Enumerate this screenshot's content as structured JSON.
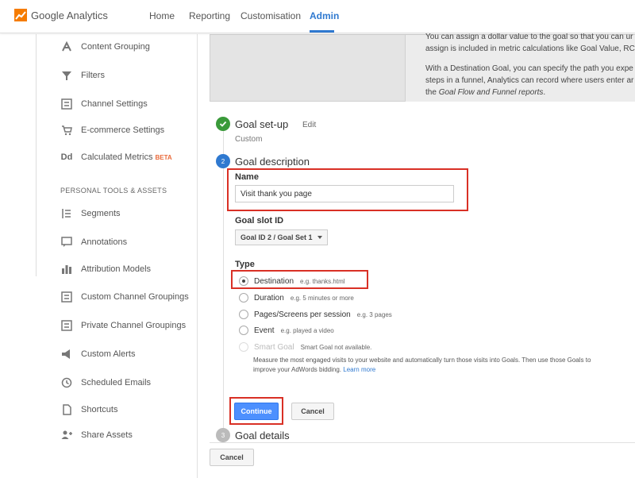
{
  "app": {
    "logo_text": "Google Analytics",
    "brand_color": "#f57c00",
    "accent": "#2f79d0"
  },
  "nav": {
    "items": [
      {
        "label": "Home"
      },
      {
        "label": "Reporting"
      },
      {
        "label": "Customisation"
      },
      {
        "label": "Admin"
      }
    ],
    "active": "Admin"
  },
  "sidebar": {
    "items": [
      {
        "label": "Content Grouping",
        "icon": "content-grouping-icon"
      },
      {
        "label": "Filters",
        "icon": "filter-icon"
      },
      {
        "label": "Channel Settings",
        "icon": "channel-settings-icon"
      },
      {
        "label": "E-commerce Settings",
        "icon": "cart-icon"
      },
      {
        "label": "Calculated Metrics",
        "icon": "calculated-metrics-icon",
        "badge": "BETA"
      }
    ],
    "section_heading": "PERSONAL TOOLS & ASSETS",
    "personal_items": [
      {
        "label": "Segments",
        "icon": "segments-icon"
      },
      {
        "label": "Annotations",
        "icon": "annotations-icon"
      },
      {
        "label": "Attribution Models",
        "icon": "attribution-icon"
      },
      {
        "label": "Custom Channel Groupings",
        "icon": "custom-channel-icon"
      },
      {
        "label": "Private Channel Groupings",
        "icon": "private-channel-icon"
      },
      {
        "label": "Custom Alerts",
        "icon": "megaphone-icon"
      },
      {
        "label": "Scheduled Emails",
        "icon": "clock-icon"
      },
      {
        "label": "Shortcuts",
        "icon": "document-icon"
      },
      {
        "label": "Share Assets",
        "icon": "add-person-icon"
      }
    ]
  },
  "info": {
    "line1": "You can assign a dollar value to the goal so that you can ur",
    "line2": "assign is included in metric calculations like Goal Value, RC",
    "line3": "With a Destination Goal, you can specify the path you expe",
    "line4": "steps in a funnel, Analytics can record where users enter ar",
    "line5_italic": "Goal Flow and Funnel reports",
    "line5_pre": "the ",
    "line5_post": "."
  },
  "steps": {
    "setup": {
      "title": "Goal set-up",
      "edit": "Edit",
      "value": "Custom"
    },
    "description": {
      "number": "2",
      "title": "Goal description"
    },
    "details": {
      "number": "3",
      "title": "Goal details"
    }
  },
  "form": {
    "name_label": "Name",
    "name_value": "Visit thank you page",
    "slot_label": "Goal slot ID",
    "slot_value": "Goal ID 2 / Goal Set 1",
    "type_label": "Type",
    "types": [
      {
        "label": "Destination",
        "hint": "e.g. thanks.html",
        "checked": true
      },
      {
        "label": "Duration",
        "hint": "e.g. 5 minutes or more",
        "checked": false
      },
      {
        "label": "Pages/Screens per session",
        "hint": "e.g. 3 pages",
        "checked": false
      },
      {
        "label": "Event",
        "hint": "e.g. played a video",
        "checked": false
      },
      {
        "label": "Smart Goal",
        "hint": "Smart Goal not available.",
        "checked": false,
        "disabled": true
      }
    ],
    "smart_desc_1": "Measure the most engaged visits to your website and automatically turn those visits into Goals. Then use those Goals to",
    "smart_desc_2": "improve your AdWords bidding.",
    "smart_link": "Learn more",
    "continue_label": "Continue",
    "cancel_label": "Cancel",
    "bottom_cancel_label": "Cancel"
  }
}
